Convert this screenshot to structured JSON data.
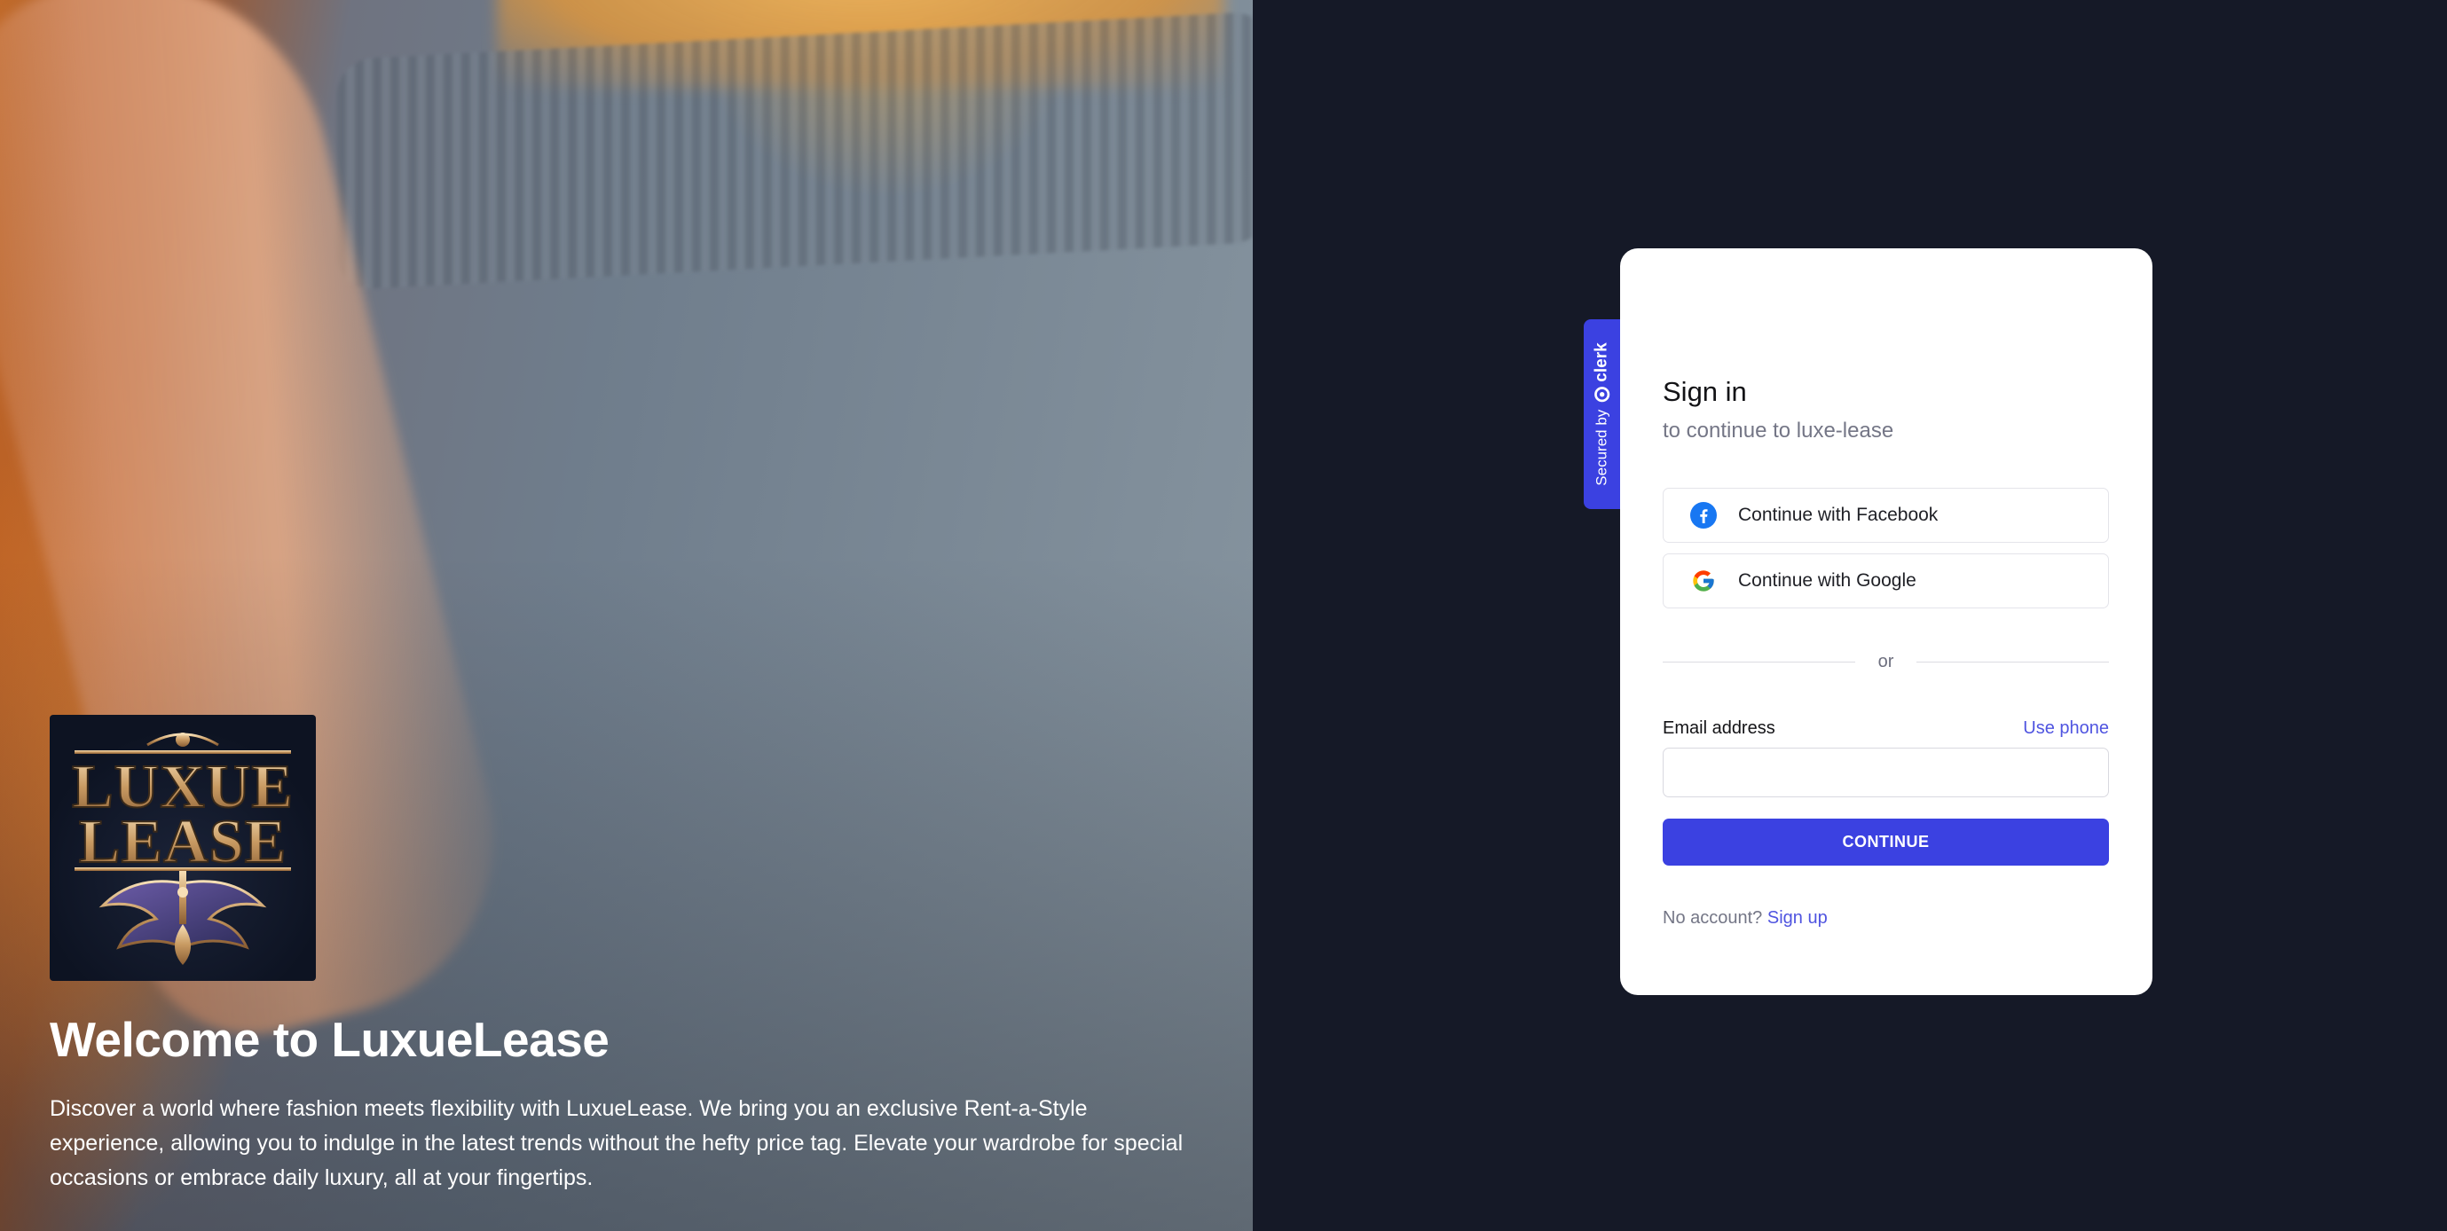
{
  "hero": {
    "logo_text": "LUXUE LEASE",
    "title": "Welcome to LuxueLease",
    "description": "Discover a world where fashion meets flexibility with LuxueLease. We bring you an exclusive Rent-a-Style experience, allowing you to indulge in the latest trends without the hefty price tag. Elevate your wardrobe for special occasions or embrace daily luxury, all at your fingertips."
  },
  "badge": {
    "secured_by": "Secured by",
    "brand": "clerk"
  },
  "signin": {
    "title": "Sign in",
    "subtitle": "to continue to luxe-lease",
    "facebook_label": "Continue with Facebook",
    "google_label": "Continue with Google",
    "divider": "or",
    "email_label": "Email address",
    "use_phone": "Use phone",
    "email_value": "",
    "continue_label": "CONTINUE",
    "no_account": "No account?",
    "sign_up": "Sign up"
  },
  "colors": {
    "page_bg": "#151927",
    "accent": "#3b41e1",
    "link": "#4f54e0",
    "facebook": "#1877f2"
  },
  "icons": {
    "facebook": "facebook-icon",
    "google": "google-icon",
    "clerk": "clerk-logo-icon"
  }
}
